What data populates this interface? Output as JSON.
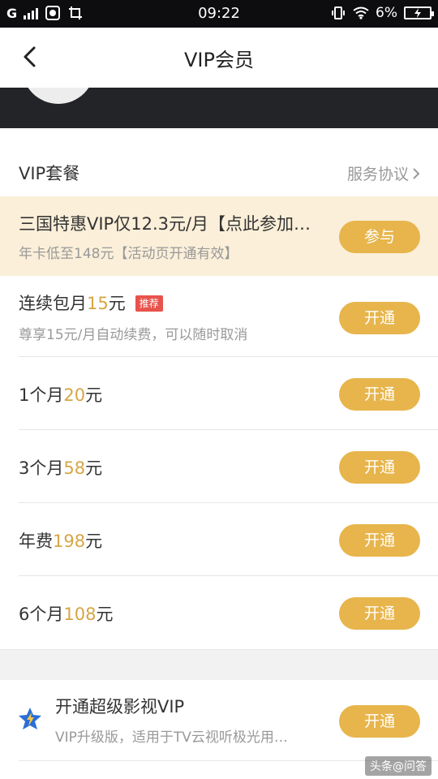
{
  "status_bar": {
    "signal": "G",
    "time": "09:22",
    "battery": "6%"
  },
  "header": {
    "title": "VIP会员",
    "back_icon": "chevron-left-icon"
  },
  "section": {
    "title": "VIP套餐",
    "agreement": "服务协议"
  },
  "promo": {
    "title": "三国特惠VIP仅12.3元/月【点此参加…",
    "subtitle": "年卡低至148元【活动页开通有效】",
    "button": "参与"
  },
  "plans": [
    {
      "prefix": "连续包月",
      "price": "15",
      "suffix": "元",
      "tag": "推荐",
      "subtitle": "尊享15元/月自动续费，可以随时取消",
      "button": "开通"
    },
    {
      "prefix": "1个月",
      "price": "20",
      "suffix": "元",
      "button": "开通"
    },
    {
      "prefix": "3个月",
      "price": "58",
      "suffix": "元",
      "button": "开通"
    },
    {
      "prefix": "年费",
      "price": "198",
      "suffix": "元",
      "button": "开通"
    },
    {
      "prefix": "6个月",
      "price": "108",
      "suffix": "元",
      "button": "开通"
    }
  ],
  "super_vip": {
    "title": "开通超级影视VIP",
    "subtitle": "VIP升级版，适用于TV云视听极光用…",
    "button": "开通",
    "icon": "star-badge-icon"
  },
  "watermark": "头条@问答",
  "colors": {
    "accent": "#e7b54c",
    "price": "#d6a646",
    "promo_bg": "#fbefd9",
    "tag": "#e8534c"
  }
}
